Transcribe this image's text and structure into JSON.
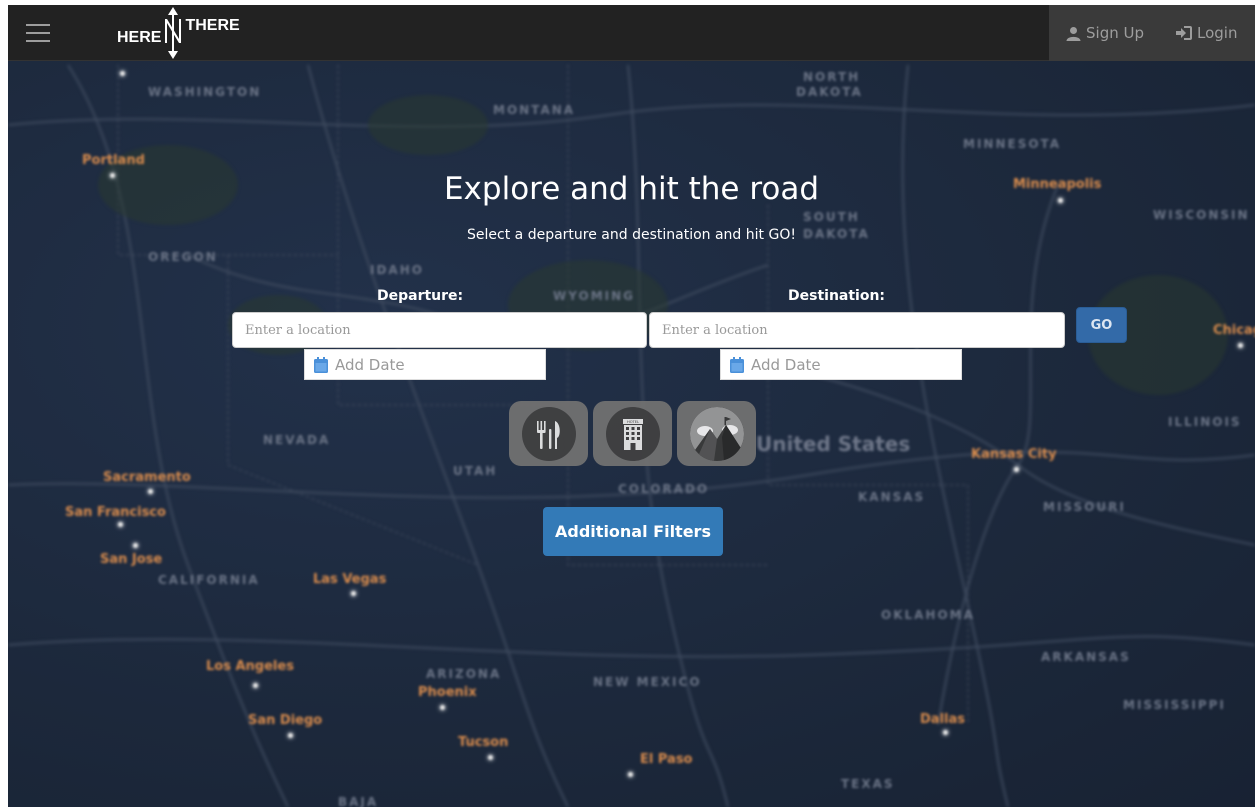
{
  "navbar": {
    "brand_left": "HERE",
    "brand_right": "THERE",
    "signup_label": "Sign Up",
    "login_label": "Login",
    "menu_icon": "hamburger-icon",
    "signup_icon": "user-icon",
    "login_icon": "login-icon"
  },
  "hero": {
    "title": "Explore and hit the road",
    "subtitle": "Select a departure and destination and hit GO!"
  },
  "search": {
    "departure_label": "Departure:",
    "destination_label": "Destination:",
    "departure_placeholder": "Enter a location",
    "destination_placeholder": "Enter a location",
    "departure_value": "",
    "destination_value": "",
    "departure_date": "Add Date",
    "destination_date": "Add Date",
    "go_label": "GO"
  },
  "categories": [
    {
      "icon": "restaurant-icon"
    },
    {
      "icon": "hotel-icon"
    },
    {
      "icon": "mountain-icon"
    }
  ],
  "filters": {
    "button_label": "Additional Filters"
  },
  "map_labels": {
    "states": [
      "WASHINGTON",
      "MONTANA",
      "NORTH",
      "DAKOTA",
      "MINNESOTA",
      "OREGON",
      "IDAHO",
      "WYOMING",
      "SOUTH",
      "DAKOTA",
      "WISCONSIN",
      "NEVADA",
      "UTAH",
      "United States",
      "COLORADO",
      "KANSAS",
      "MISSOURI",
      "ILLINOIS",
      "CALIFORNIA",
      "OKLAHOMA",
      "ARIZONA",
      "NEW MEXICO",
      "ARKANSAS",
      "MISSISSIPPI",
      "TEXAS",
      "BAJA"
    ],
    "cities": [
      "Portland",
      "Minneapolis",
      "Chicago",
      "Sacramento",
      "San Francisco",
      "San Jose",
      "Las Vegas",
      "Kansas City",
      "Los Angeles",
      "Phoenix",
      "San Diego",
      "Tucson",
      "El Paso",
      "Dallas"
    ]
  },
  "colors": {
    "navbar_bg": "#222222",
    "primary": "#337ab7",
    "go_button": "#336aa8",
    "map_bg": "#1d2a3d",
    "city_label": "#d98c4d"
  }
}
